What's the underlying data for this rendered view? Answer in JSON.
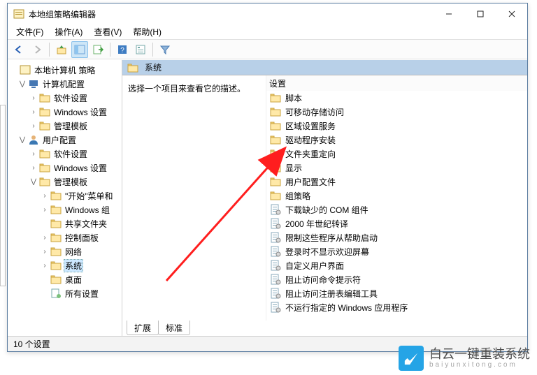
{
  "window": {
    "title": "本地组策略编辑器",
    "menus": [
      "文件(F)",
      "操作(A)",
      "查看(V)",
      "帮助(H)"
    ]
  },
  "tree": {
    "root": "本地计算机 策略",
    "computer": {
      "label": "计算机配置",
      "children": [
        "软件设置",
        "Windows 设置",
        "管理模板"
      ]
    },
    "user": {
      "label": "用户配置",
      "children": [
        "软件设置",
        "Windows 设置"
      ],
      "adminTemplates": {
        "label": "管理模板",
        "children": [
          "\"开始\"菜单和",
          "Windows 组",
          "共享文件夹",
          "控制面板",
          "网络",
          "系统",
          "桌面",
          "所有设置"
        ],
        "selectedIndex": 5
      }
    }
  },
  "right": {
    "pathLabel": "系统",
    "descPrompt": "选择一个项目来查看它的描述。",
    "colHeader": "设置",
    "folders": [
      "脚本",
      "可移动存储访问",
      "区域设置服务",
      "驱动程序安装",
      "文件夹重定向",
      "显示",
      "用户配置文件",
      "组策略"
    ],
    "settings": [
      "下载缺少的 COM 组件",
      "2000 年世纪转译",
      "限制这些程序从帮助启动",
      "登录时不显示欢迎屏幕",
      "自定义用户界面",
      "阻止访问命令提示符",
      "阻止访问注册表编辑工具",
      "不运行指定的 Windows 应用程序"
    ]
  },
  "tabs": {
    "active": "扩展",
    "inactive": "标准"
  },
  "status": "10 个设置",
  "watermark": {
    "brand": "白云一键重装系统",
    "sub": "baiyunxitong.com"
  }
}
